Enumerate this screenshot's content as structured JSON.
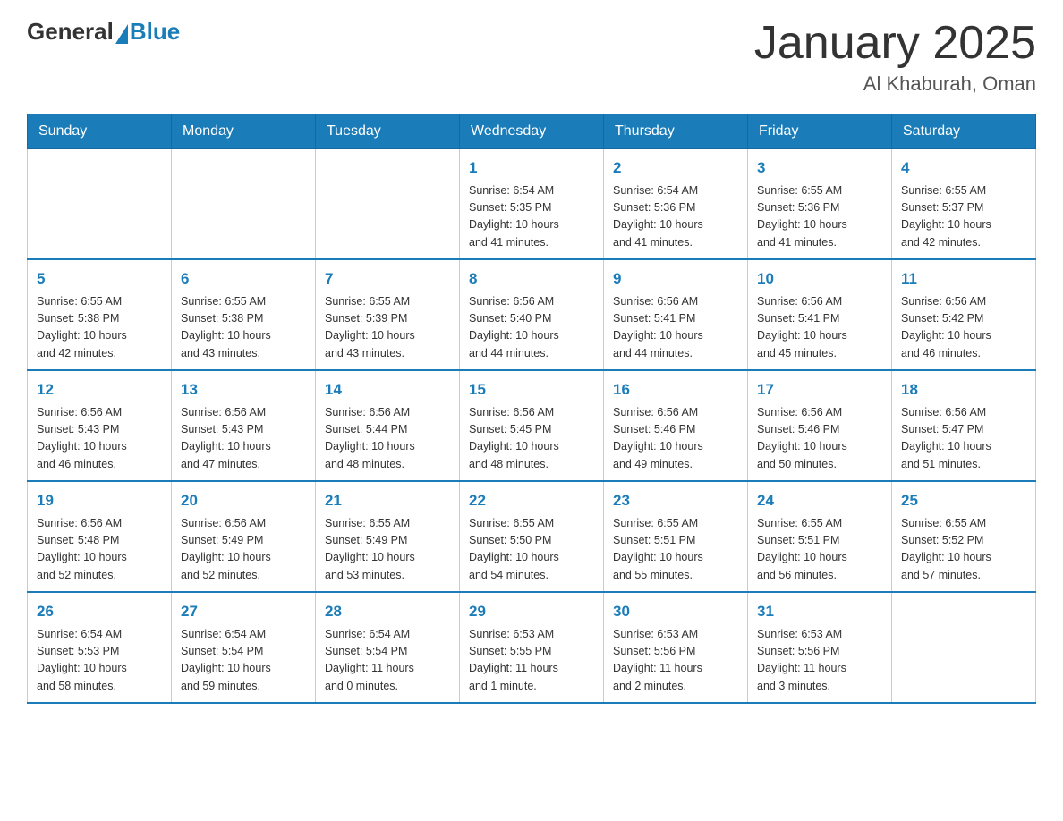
{
  "header": {
    "logo_general": "General",
    "logo_blue": "Blue",
    "month_title": "January 2025",
    "location": "Al Khaburah, Oman"
  },
  "days_of_week": [
    "Sunday",
    "Monday",
    "Tuesday",
    "Wednesday",
    "Thursday",
    "Friday",
    "Saturday"
  ],
  "weeks": [
    [
      {
        "day": "",
        "info": ""
      },
      {
        "day": "",
        "info": ""
      },
      {
        "day": "",
        "info": ""
      },
      {
        "day": "1",
        "info": "Sunrise: 6:54 AM\nSunset: 5:35 PM\nDaylight: 10 hours\nand 41 minutes."
      },
      {
        "day": "2",
        "info": "Sunrise: 6:54 AM\nSunset: 5:36 PM\nDaylight: 10 hours\nand 41 minutes."
      },
      {
        "day": "3",
        "info": "Sunrise: 6:55 AM\nSunset: 5:36 PM\nDaylight: 10 hours\nand 41 minutes."
      },
      {
        "day": "4",
        "info": "Sunrise: 6:55 AM\nSunset: 5:37 PM\nDaylight: 10 hours\nand 42 minutes."
      }
    ],
    [
      {
        "day": "5",
        "info": "Sunrise: 6:55 AM\nSunset: 5:38 PM\nDaylight: 10 hours\nand 42 minutes."
      },
      {
        "day": "6",
        "info": "Sunrise: 6:55 AM\nSunset: 5:38 PM\nDaylight: 10 hours\nand 43 minutes."
      },
      {
        "day": "7",
        "info": "Sunrise: 6:55 AM\nSunset: 5:39 PM\nDaylight: 10 hours\nand 43 minutes."
      },
      {
        "day": "8",
        "info": "Sunrise: 6:56 AM\nSunset: 5:40 PM\nDaylight: 10 hours\nand 44 minutes."
      },
      {
        "day": "9",
        "info": "Sunrise: 6:56 AM\nSunset: 5:41 PM\nDaylight: 10 hours\nand 44 minutes."
      },
      {
        "day": "10",
        "info": "Sunrise: 6:56 AM\nSunset: 5:41 PM\nDaylight: 10 hours\nand 45 minutes."
      },
      {
        "day": "11",
        "info": "Sunrise: 6:56 AM\nSunset: 5:42 PM\nDaylight: 10 hours\nand 46 minutes."
      }
    ],
    [
      {
        "day": "12",
        "info": "Sunrise: 6:56 AM\nSunset: 5:43 PM\nDaylight: 10 hours\nand 46 minutes."
      },
      {
        "day": "13",
        "info": "Sunrise: 6:56 AM\nSunset: 5:43 PM\nDaylight: 10 hours\nand 47 minutes."
      },
      {
        "day": "14",
        "info": "Sunrise: 6:56 AM\nSunset: 5:44 PM\nDaylight: 10 hours\nand 48 minutes."
      },
      {
        "day": "15",
        "info": "Sunrise: 6:56 AM\nSunset: 5:45 PM\nDaylight: 10 hours\nand 48 minutes."
      },
      {
        "day": "16",
        "info": "Sunrise: 6:56 AM\nSunset: 5:46 PM\nDaylight: 10 hours\nand 49 minutes."
      },
      {
        "day": "17",
        "info": "Sunrise: 6:56 AM\nSunset: 5:46 PM\nDaylight: 10 hours\nand 50 minutes."
      },
      {
        "day": "18",
        "info": "Sunrise: 6:56 AM\nSunset: 5:47 PM\nDaylight: 10 hours\nand 51 minutes."
      }
    ],
    [
      {
        "day": "19",
        "info": "Sunrise: 6:56 AM\nSunset: 5:48 PM\nDaylight: 10 hours\nand 52 minutes."
      },
      {
        "day": "20",
        "info": "Sunrise: 6:56 AM\nSunset: 5:49 PM\nDaylight: 10 hours\nand 52 minutes."
      },
      {
        "day": "21",
        "info": "Sunrise: 6:55 AM\nSunset: 5:49 PM\nDaylight: 10 hours\nand 53 minutes."
      },
      {
        "day": "22",
        "info": "Sunrise: 6:55 AM\nSunset: 5:50 PM\nDaylight: 10 hours\nand 54 minutes."
      },
      {
        "day": "23",
        "info": "Sunrise: 6:55 AM\nSunset: 5:51 PM\nDaylight: 10 hours\nand 55 minutes."
      },
      {
        "day": "24",
        "info": "Sunrise: 6:55 AM\nSunset: 5:51 PM\nDaylight: 10 hours\nand 56 minutes."
      },
      {
        "day": "25",
        "info": "Sunrise: 6:55 AM\nSunset: 5:52 PM\nDaylight: 10 hours\nand 57 minutes."
      }
    ],
    [
      {
        "day": "26",
        "info": "Sunrise: 6:54 AM\nSunset: 5:53 PM\nDaylight: 10 hours\nand 58 minutes."
      },
      {
        "day": "27",
        "info": "Sunrise: 6:54 AM\nSunset: 5:54 PM\nDaylight: 10 hours\nand 59 minutes."
      },
      {
        "day": "28",
        "info": "Sunrise: 6:54 AM\nSunset: 5:54 PM\nDaylight: 11 hours\nand 0 minutes."
      },
      {
        "day": "29",
        "info": "Sunrise: 6:53 AM\nSunset: 5:55 PM\nDaylight: 11 hours\nand 1 minute."
      },
      {
        "day": "30",
        "info": "Sunrise: 6:53 AM\nSunset: 5:56 PM\nDaylight: 11 hours\nand 2 minutes."
      },
      {
        "day": "31",
        "info": "Sunrise: 6:53 AM\nSunset: 5:56 PM\nDaylight: 11 hours\nand 3 minutes."
      },
      {
        "day": "",
        "info": ""
      }
    ]
  ]
}
